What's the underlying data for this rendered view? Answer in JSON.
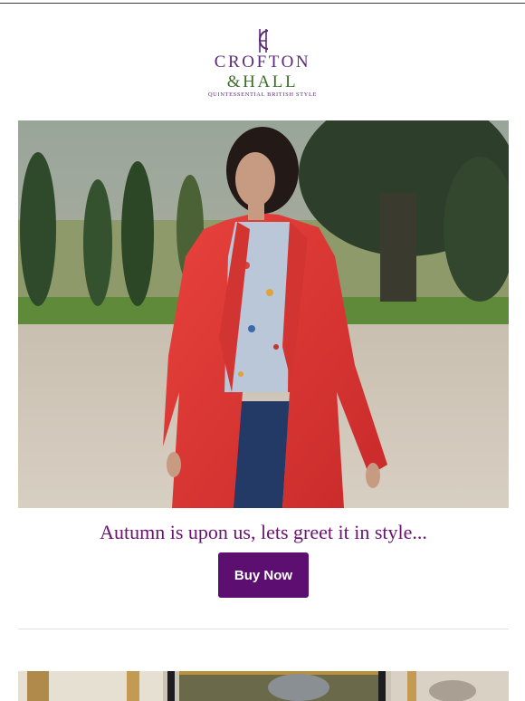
{
  "brand": {
    "monogram": "CH",
    "line1": "CROFTON",
    "line2": "&HALL",
    "tagline": "QUINTESSENTIAL BRITISH STYLE",
    "colors": {
      "purple": "#5b2a78",
      "green": "#3e6b2a"
    }
  },
  "hero": {
    "image_icon": "photo-woman-red-coat"
  },
  "promo": {
    "headline": "Autumn is upon us, lets greet it in style...",
    "button_label": "Buy Now",
    "headline_color": "#6a1472",
    "button_color": "#5c0f70"
  },
  "next_section": {
    "image_icon": "photo-interior-gilded-frames"
  }
}
